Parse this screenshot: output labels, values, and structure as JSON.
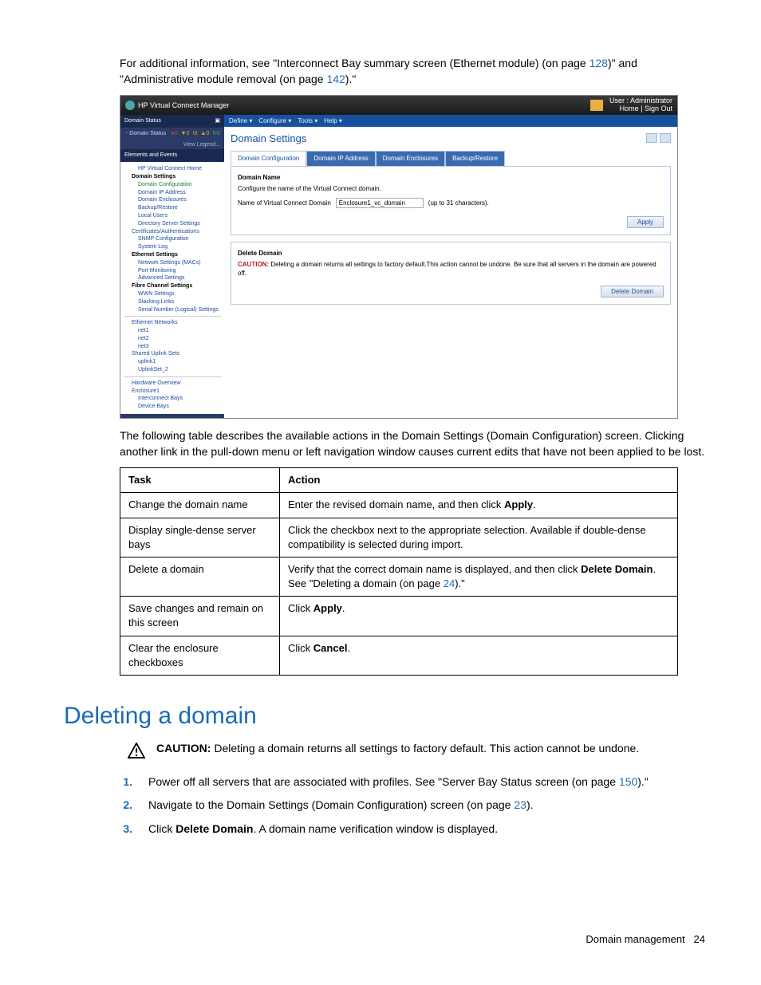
{
  "intro": {
    "pre": "For additional information, see \"Interconnect Bay summary screen (Ethernet module) (on page ",
    "link1": "128",
    "mid": ")\" and \"Administrative module removal (on page ",
    "link2": "142",
    "post": ").\""
  },
  "screenshot": {
    "title": "HP Virtual Connect Manager",
    "user_line1": "User : Administrator",
    "user_line2": "Home  |  Sign Out",
    "side": {
      "domain_status_header": "Domain Status",
      "domain_status_label": "Domain Status",
      "status_counts": [
        "0",
        "0",
        "0",
        "0",
        "0"
      ],
      "view_legend": "View Legend...",
      "ee_header": "Elements and Events",
      "tree": [
        {
          "lvl": 1,
          "txt": "HP Virtual Connect Home"
        },
        {
          "lvl": 0,
          "txt": "Domain Settings",
          "bold": true
        },
        {
          "lvl": 1,
          "txt": "Domain Configuration",
          "hl": true
        },
        {
          "lvl": 1,
          "txt": "Domain IP Address"
        },
        {
          "lvl": 1,
          "txt": "Domain Enclosures"
        },
        {
          "lvl": 1,
          "txt": "Backup/Restore"
        },
        {
          "lvl": 1,
          "txt": "Local Users"
        },
        {
          "lvl": 1,
          "txt": "Directory Server Settings"
        },
        {
          "lvl": 0,
          "txt": "Certificates/Authentications"
        },
        {
          "lvl": 1,
          "txt": "SNMP Configuration"
        },
        {
          "lvl": 1,
          "txt": "System Log"
        },
        {
          "lvl": 0,
          "txt": "Ethernet Settings",
          "bold": true
        },
        {
          "lvl": 1,
          "txt": "Network Settings (MACs)"
        },
        {
          "lvl": 1,
          "txt": "Port Monitoring"
        },
        {
          "lvl": 1,
          "txt": "Advanced Settings"
        },
        {
          "lvl": 0,
          "txt": "Fibre Channel Settings",
          "bold": true
        },
        {
          "lvl": 1,
          "txt": "WWN Settings"
        },
        {
          "lvl": 1,
          "txt": "Stacking Links"
        },
        {
          "lvl": 1,
          "txt": "Serial Number (Logical) Settings"
        },
        {
          "lvl": -1,
          "sep": true
        },
        {
          "lvl": 0,
          "txt": "Ethernet Networks"
        },
        {
          "lvl": 1,
          "txt": "net1"
        },
        {
          "lvl": 1,
          "txt": "net2"
        },
        {
          "lvl": 1,
          "txt": "net3"
        },
        {
          "lvl": 0,
          "txt": "Shared Uplink Sets"
        },
        {
          "lvl": 1,
          "txt": "uplink1"
        },
        {
          "lvl": 1,
          "txt": "UplinkSet_2"
        },
        {
          "lvl": -1,
          "sep": true
        },
        {
          "lvl": 0,
          "txt": "Hardware Overview"
        },
        {
          "lvl": 0,
          "txt": "Enclosure1"
        },
        {
          "lvl": 1,
          "txt": "Interconnect Bays"
        },
        {
          "lvl": 1,
          "txt": "Device Bays"
        }
      ]
    },
    "menubar": [
      "Define ▾",
      "Configure ▾",
      "Tools ▾",
      "Help ▾"
    ],
    "page_title": "Domain Settings",
    "tabs": [
      "Domain Configuration",
      "Domain IP Address",
      "Domain Enclosures",
      "Backup/Restore"
    ],
    "panel1": {
      "heading": "Domain Name",
      "desc": "Configure the name of the Virtual Connect domain.",
      "label": "Name of Virtual Connect Domain",
      "value": "Enclosure1_vc_domain",
      "hint": "(up to 31 characters).",
      "apply": "Apply"
    },
    "panel2": {
      "heading": "Delete Domain",
      "caution_label": "CAUTION:",
      "caution_text": " Deleting a domain returns all settings to factory default.This action cannot be undone. Be sure that all servers in the domain are powered off.",
      "delete": "Delete Domain"
    }
  },
  "table_intro": "The following table describes the available actions in the Domain Settings (Domain Configuration) screen. Clicking another link in the pull-down menu or left navigation window causes current edits that have not been applied to be lost.",
  "table": {
    "headers": [
      "Task",
      "Action"
    ],
    "rows": [
      {
        "task": "Change the domain name",
        "action_pre": "Enter the revised domain name, and then click ",
        "action_b": "Apply",
        "action_post": "."
      },
      {
        "task": "Display single-dense server bays",
        "action_pre": "Click the checkbox next to the appropriate selection. Available if double-dense compatibility is selected during import.",
        "action_b": "",
        "action_post": ""
      },
      {
        "task": "Delete a domain",
        "action_pre": "Verify that the correct domain name is displayed, and then click ",
        "action_b": "Delete Domain",
        "action_post": ". See \"Deleting a domain (on page ",
        "action_link": "24",
        "action_tail": ").\""
      },
      {
        "task": "Save changes and remain on this screen",
        "action_pre": "Click ",
        "action_b": "Apply",
        "action_post": "."
      },
      {
        "task": "Clear the enclosure checkboxes",
        "action_pre": "Click ",
        "action_b": "Cancel",
        "action_post": "."
      }
    ]
  },
  "section_heading": "Deleting a domain",
  "caution": {
    "label": "CAUTION:",
    "text": "  Deleting a domain returns all settings to factory default. This action cannot be undone."
  },
  "steps": [
    {
      "num": "1.",
      "pre": "Power off all servers that are associated with profiles. See \"Server Bay Status screen (on page ",
      "link": "150",
      "post": ").\""
    },
    {
      "num": "2.",
      "pre": "Navigate to the Domain Settings (Domain Configuration) screen (on page ",
      "link": "23",
      "post": ")."
    },
    {
      "num": "3.",
      "pre": "Click ",
      "b": "Delete Domain",
      "post": ". A domain name verification window is displayed."
    }
  ],
  "footer": {
    "label": "Domain management",
    "page": "24"
  }
}
